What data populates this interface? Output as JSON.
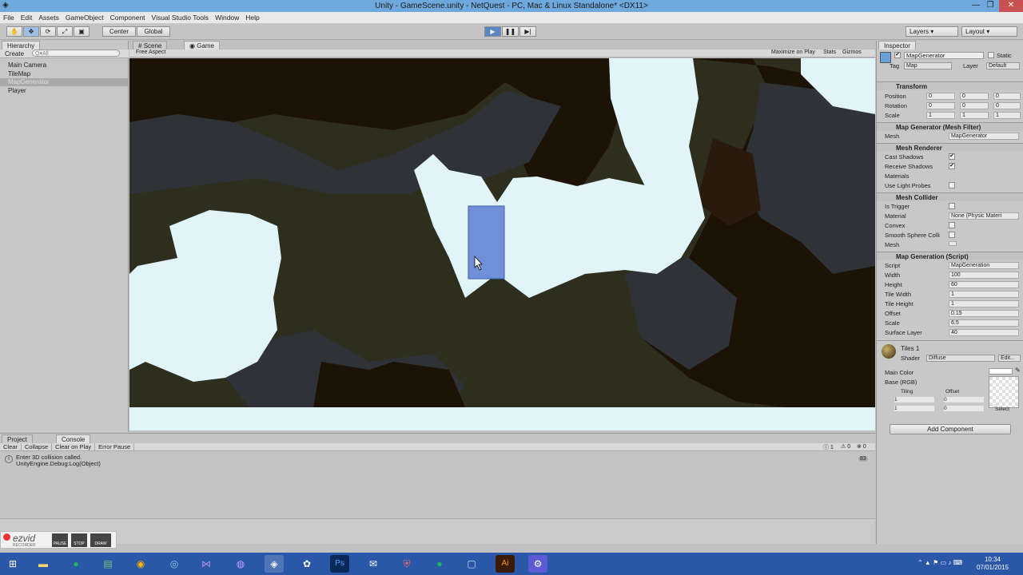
{
  "window": {
    "title": "Unity - GameScene.unity - NetQuest - PC, Mac & Linux Standalone* <DX11>",
    "minimize": "—",
    "maximize": "❐",
    "close": "✕"
  },
  "menu": [
    "File",
    "Edit",
    "Assets",
    "GameObject",
    "Component",
    "Visual Studio Tools",
    "Window",
    "Help"
  ],
  "toolbar": {
    "pivot": "Center",
    "space": "Global",
    "layers": "Layers",
    "layout": "Layout"
  },
  "hierarchy": {
    "tab": "Hierarchy",
    "create": "Create",
    "search_placeholder": "Q▾All",
    "items": [
      "Main Camera",
      "TileMap",
      "MapGenerator",
      "Player"
    ]
  },
  "game": {
    "tabs": [
      "Scene",
      "Game"
    ],
    "aspect": "Free Aspect",
    "options": [
      "Maximize on Play",
      "Stats",
      "Gizmos"
    ]
  },
  "inspector": {
    "tab": "Inspector",
    "name": "MapGenerator",
    "static": "Static",
    "tag_label": "Tag",
    "tag": "Map",
    "layer_label": "Layer",
    "layer": "Default",
    "transform": {
      "title": "Transform",
      "position_label": "Position",
      "rotation_label": "Rotation",
      "scale_label": "Scale",
      "position": [
        "0",
        "0",
        "0"
      ],
      "rotation": [
        "0",
        "0",
        "0"
      ],
      "scale": [
        "1",
        "1",
        "1"
      ]
    },
    "mesh_filter": {
      "title": "Map Generator (Mesh Filter)",
      "mesh_label": "Mesh",
      "mesh": "MapGenerator"
    },
    "mesh_renderer": {
      "title": "Mesh Renderer",
      "cast_shadows": "Cast Shadows",
      "receive_shadows": "Receive Shadows",
      "materials": "Materials",
      "use_light_probes": "Use Light Probes"
    },
    "mesh_collider": {
      "title": "Mesh Collider",
      "is_trigger": "Is Trigger",
      "material_label": "Material",
      "material": "None (Physic Materi",
      "convex": "Convex",
      "smooth": "Smooth Sphere Colli",
      "mesh_label": "Mesh"
    },
    "map_generation": {
      "title": "Map Generation (Script)",
      "fields": [
        {
          "label": "Script",
          "value": "MapGeneration"
        },
        {
          "label": "Width",
          "value": "100"
        },
        {
          "label": "Height",
          "value": "60"
        },
        {
          "label": "Tile Width",
          "value": "1"
        },
        {
          "label": "Tile Height",
          "value": "1"
        },
        {
          "label": "Offset",
          "value": "0.15"
        },
        {
          "label": "Scale",
          "value": "6.5"
        },
        {
          "label": "Surface Layer",
          "value": "40"
        }
      ]
    },
    "material": {
      "name": "Tiles 1",
      "shader_label": "Shader",
      "shader": "Diffuse",
      "edit": "Edit...",
      "main_color": "Main Color",
      "base": "Base (RGB)",
      "tiling": "Tiling",
      "offset": "Offset",
      "tiling_x": "1",
      "tiling_y": "1",
      "offset_x": "0",
      "offset_y": "0",
      "select": "Select"
    },
    "add_component": "Add Component"
  },
  "console": {
    "tabs": [
      "Project",
      "Console"
    ],
    "buttons": [
      "Clear",
      "Collapse",
      "Clear on Play",
      "Error Pause"
    ],
    "counts": [
      "1",
      "0",
      "0"
    ],
    "message_line1": "Enter 3D collision called.",
    "message_line2": "UnityEngine.Debug:Log(Object)",
    "message_count": "83"
  },
  "recorder": {
    "brand": "ezvid",
    "sub": "RECORDER",
    "pause": "PAUSE",
    "stop": "STOP",
    "draw": "DRAW"
  },
  "taskbar": {
    "time": "10:34",
    "date": "07/01/2015"
  },
  "colors": {
    "cave_light": "#e1f4f8",
    "rock_dark": "#1c1206",
    "rock_gray": "#2f3236",
    "rock_olive": "#2e2e1e",
    "player": "#6f8fd8"
  }
}
